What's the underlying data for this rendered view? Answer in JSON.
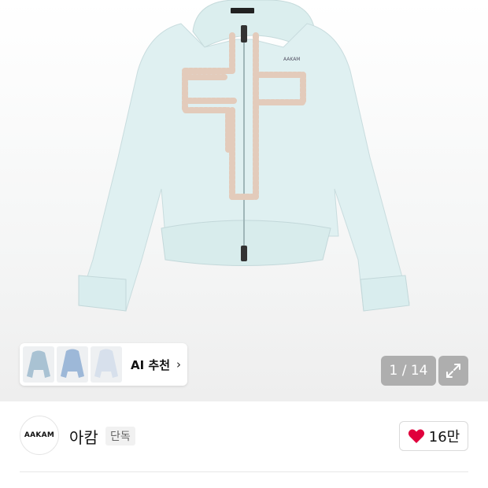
{
  "product": {
    "image_alt": "AAKAM cross-studded zip hoodie, mint",
    "garment_label": "AAKAM"
  },
  "ai_recommend": {
    "label": "AI 추천",
    "chevron": "chevron-right-icon"
  },
  "gallery": {
    "counter": "1 / 14",
    "expand_icon": "expand-icon"
  },
  "brand": {
    "logo_text": "AAKAM",
    "name": "아캄",
    "badge": "단독"
  },
  "like": {
    "icon": "heart-icon",
    "count": "16만",
    "color": "#e0003c"
  },
  "colors": {
    "hoodie": "#dff0f1",
    "hoodie_shadow": "#c7dcde",
    "studs": "#e2cbbd"
  }
}
